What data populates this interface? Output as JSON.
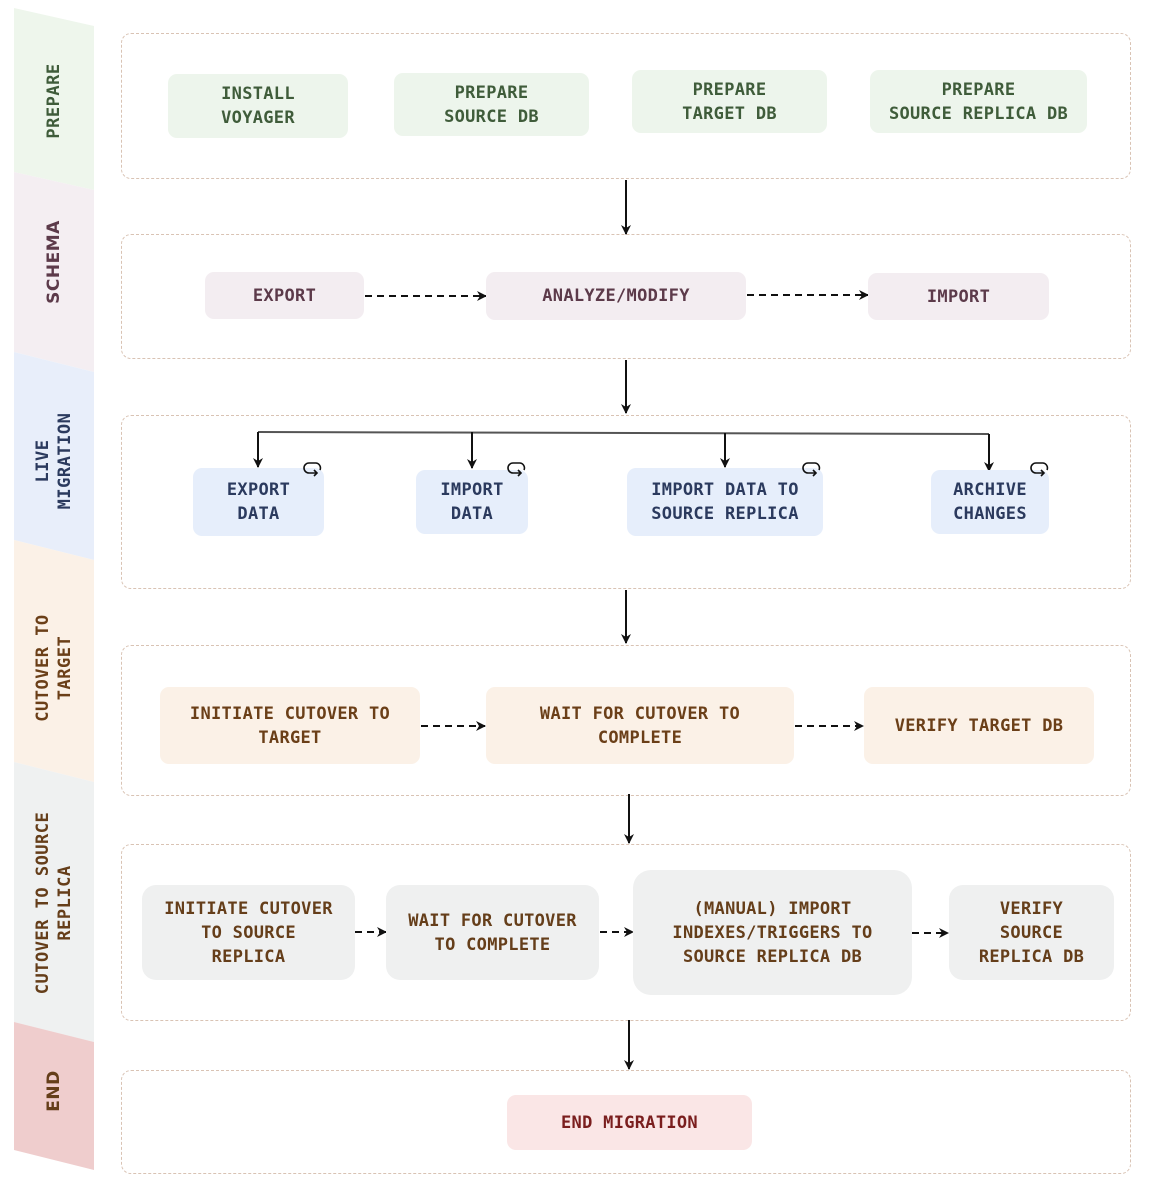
{
  "colors": {
    "prepare": {
      "lane": "#eef6ec",
      "text": "#3f5c3a"
    },
    "schema": {
      "lane": "#f4eef2",
      "text": "#5c3a4a"
    },
    "live_migration": {
      "lane": "#e8eefa",
      "text": "#2b3a5e"
    },
    "cutover_target": {
      "lane": "#fbf1e7",
      "text": "#6b3f18"
    },
    "cutover_source_replica": {
      "lane": "#eff1f1",
      "text": "#653e1a"
    },
    "end": {
      "lane": "#efcdcd",
      "text": "#653e1a"
    },
    "phase_border": "#d9c3b4",
    "arrow": "#111111"
  },
  "lanes": [
    {
      "id": "prepare",
      "label": "PREPARE"
    },
    {
      "id": "schema",
      "label": "SCHEMA"
    },
    {
      "id": "live_migration",
      "label": "LIVE\nMIGRATION"
    },
    {
      "id": "cutover_target",
      "label": "CUTOVER TO\nTARGET"
    },
    {
      "id": "cutover_source_replica",
      "label": "CUTOVER TO SOURCE\nREPLICA"
    },
    {
      "id": "end",
      "label": "END"
    }
  ],
  "nodes": {
    "install_voyager": "INSTALL\nVOYAGER",
    "prepare_source_db": "PREPARE\nSOURCE DB",
    "prepare_target_db": "PREPARE\nTARGET DB",
    "prepare_source_replica_db": "PREPARE\nSOURCE REPLICA DB",
    "export": "EXPORT",
    "analyze_modify": "ANALYZE/MODIFY",
    "import": "IMPORT",
    "export_data": "EXPORT\nDATA",
    "import_data": "IMPORT\nDATA",
    "import_data_to_source_replica": "IMPORT DATA TO\nSOURCE REPLICA",
    "archive_changes": "ARCHIVE\nCHANGES",
    "initiate_cutover_to_target": "INITIATE CUTOVER TO\nTARGET",
    "wait_for_cutover_to_complete_target": "WAIT FOR CUTOVER TO\nCOMPLETE",
    "verify_target_db": "VERIFY TARGET DB",
    "initiate_cutover_to_source_replica": "INITIATE CUTOVER\nTO SOURCE\nREPLICA",
    "wait_for_cutover_to_complete_source": "WAIT FOR CUTOVER\nTO COMPLETE",
    "manual_import_indexes_triggers": "(MANUAL) IMPORT\nINDEXES/TRIGGERS TO\nSOURCE REPLICA DB",
    "verify_source_replica_db": "VERIFY\nSOURCE\nREPLICA DB",
    "end_migration": "END MIGRATION"
  },
  "edges": [
    {
      "from": "prepare",
      "to": "schema",
      "style": "solid"
    },
    {
      "from": "export",
      "to": "analyze_modify",
      "style": "dashed"
    },
    {
      "from": "analyze_modify",
      "to": "import",
      "style": "dashed"
    },
    {
      "from": "schema",
      "to": "live_migration",
      "style": "solid"
    },
    {
      "from": "live_migration",
      "to": [
        "export_data",
        "import_data",
        "import_data_to_source_replica",
        "archive_changes"
      ],
      "style": "solid-fork"
    },
    {
      "from": "live_migration",
      "to": "cutover_target",
      "style": "solid"
    },
    {
      "from": "initiate_cutover_to_target",
      "to": "wait_for_cutover_to_complete_target",
      "style": "dashed"
    },
    {
      "from": "wait_for_cutover_to_complete_target",
      "to": "verify_target_db",
      "style": "dashed"
    },
    {
      "from": "cutover_target",
      "to": "cutover_source_replica",
      "style": "solid"
    },
    {
      "from": "initiate_cutover_to_source_replica",
      "to": "wait_for_cutover_to_complete_source",
      "style": "dashed"
    },
    {
      "from": "wait_for_cutover_to_complete_source",
      "to": "manual_import_indexes_triggers",
      "style": "dashed"
    },
    {
      "from": "manual_import_indexes_triggers",
      "to": "verify_source_replica_db",
      "style": "dashed"
    },
    {
      "from": "cutover_source_replica",
      "to": "end",
      "style": "solid"
    }
  ],
  "icons": {
    "loop": "loop-arrow-icon"
  }
}
